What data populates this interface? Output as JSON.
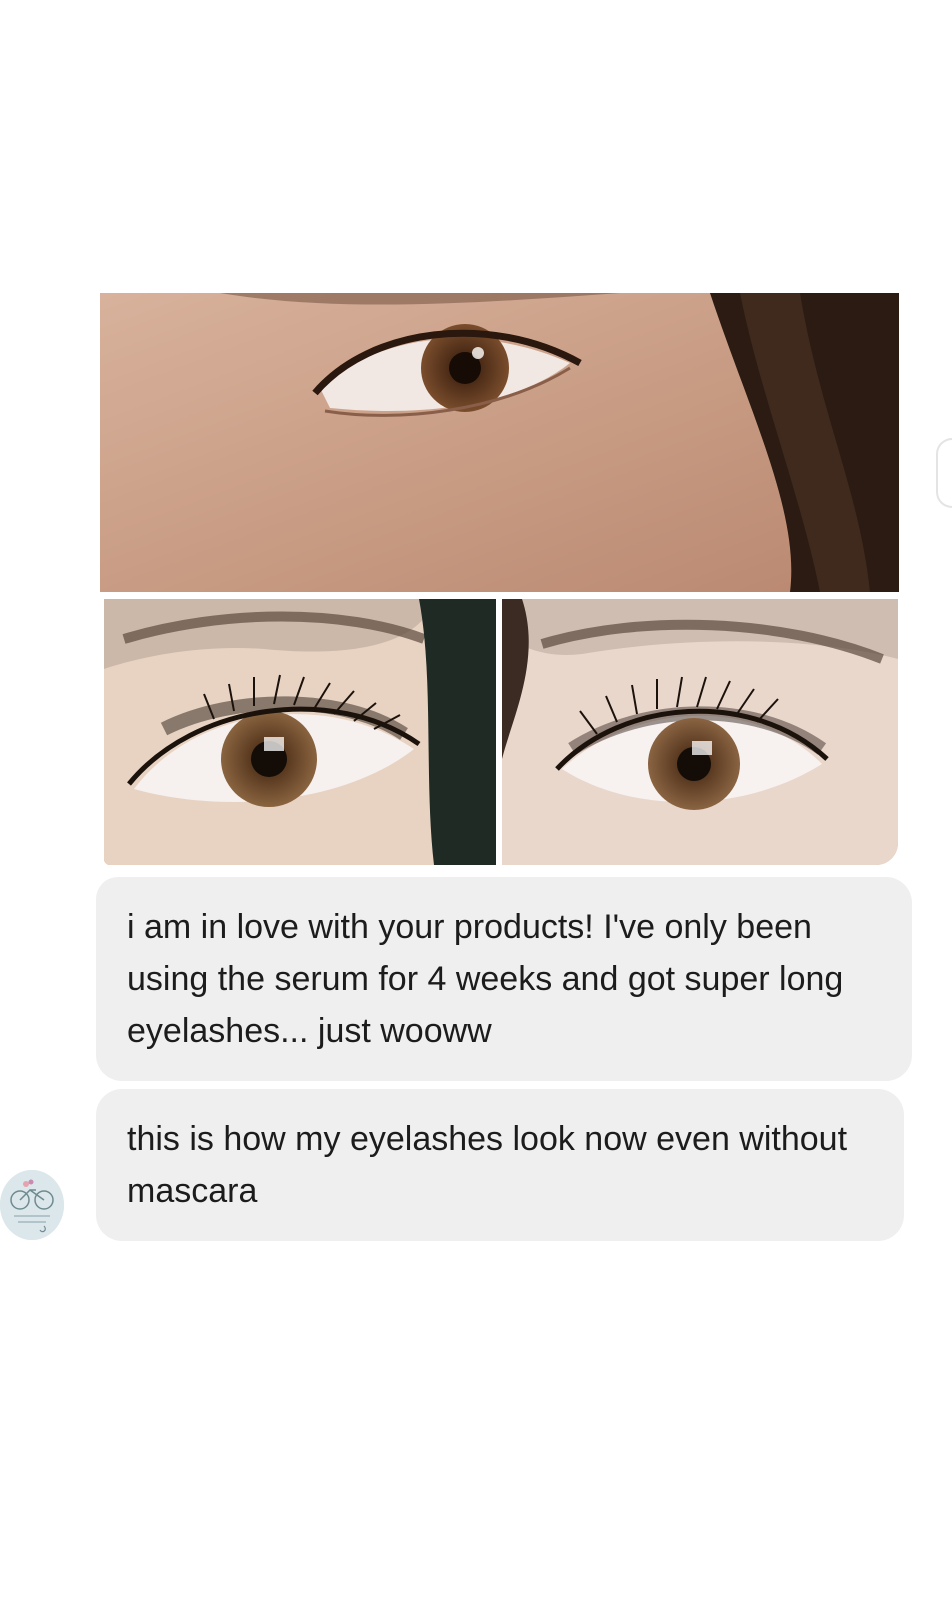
{
  "messages": [
    {
      "text": "i am in love with your products! I've only been using the serum for 4 weeks and got super long eyelashes... just wooww"
    },
    {
      "text": "this is how my eyelashes look now even without mascara"
    }
  ],
  "photos": {
    "top": {
      "icon": "eye-closeup-photo"
    },
    "left": {
      "icon": "eye-lashes-photo"
    },
    "right": {
      "icon": "eye-lashes-photo"
    }
  },
  "avatar": {
    "icon": "bicycle-logo-icon"
  },
  "colors": {
    "bubble": "#efefef",
    "text": "#1c1c1c",
    "background": "#ffffff",
    "iris": "#6b4326",
    "skin": "#c9a48c"
  }
}
